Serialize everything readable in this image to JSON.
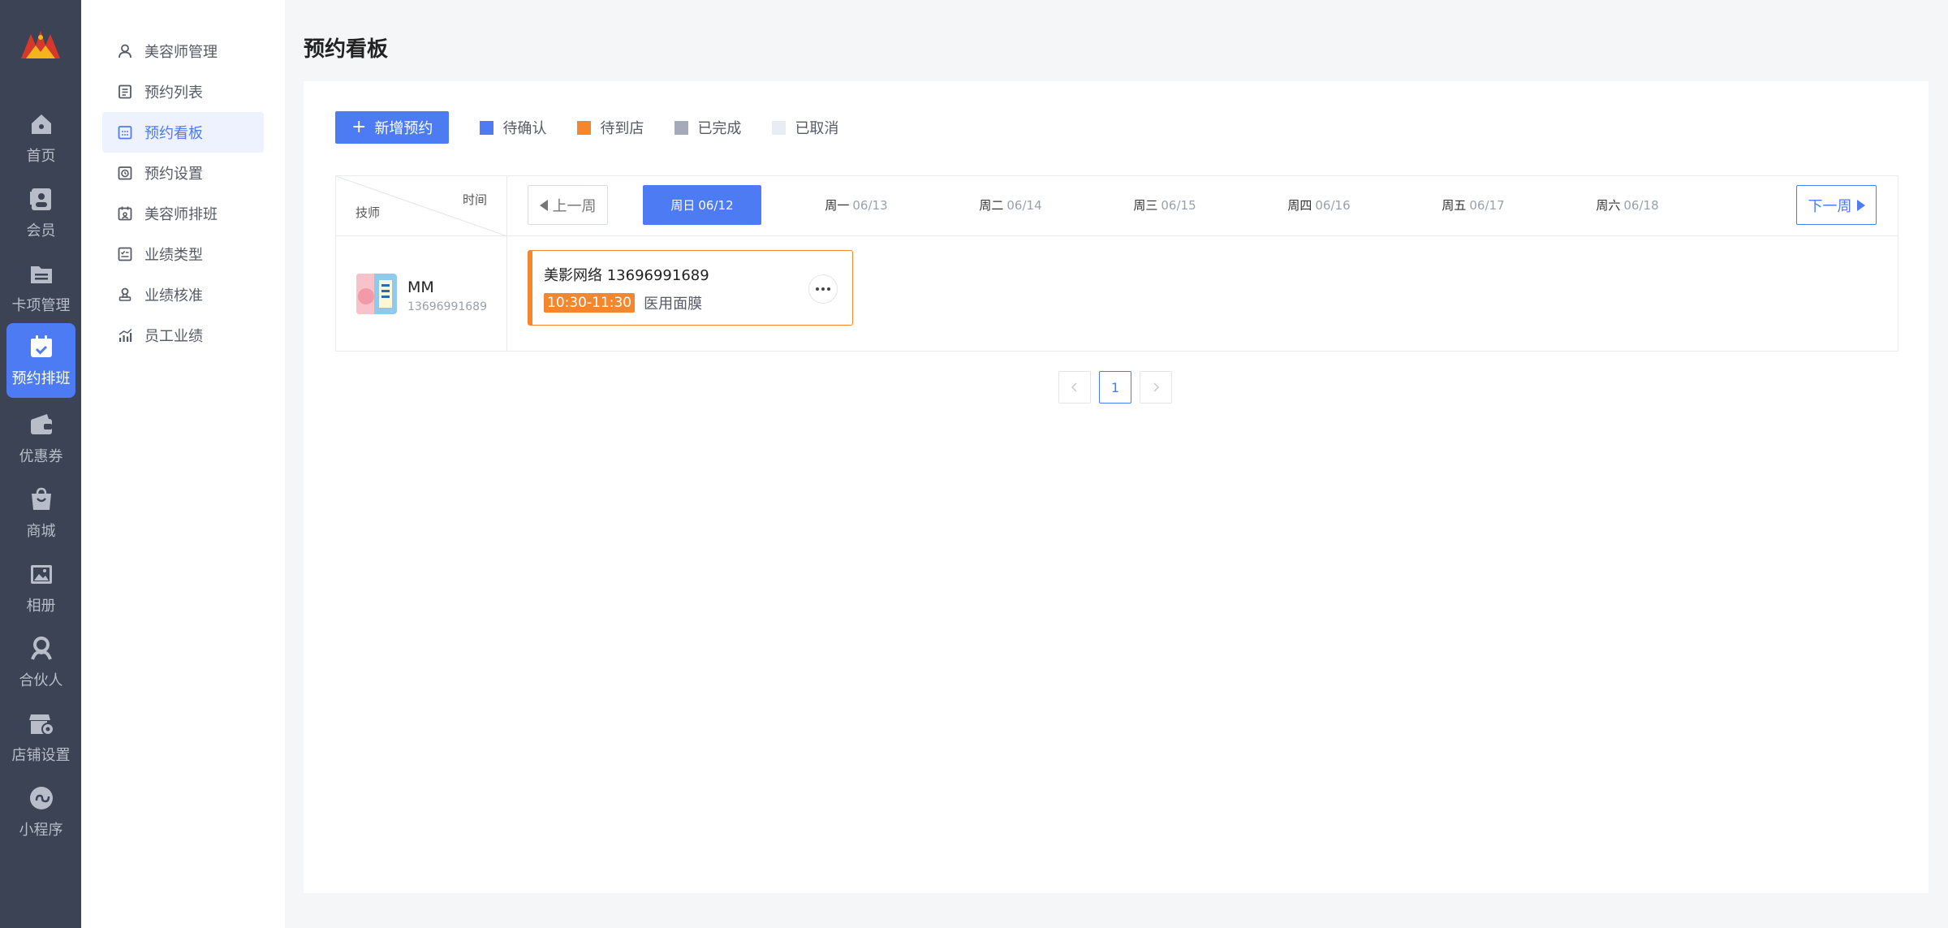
{
  "colors": {
    "accent": "#4d7bf3",
    "rail_bg": "#3b4354",
    "pending_confirm": "#4d7bf3",
    "pending_arrival": "#f5862b",
    "completed": "#a5aab8",
    "cancelled": "#e8ecf4"
  },
  "rail": {
    "items": [
      {
        "label": "首页",
        "icon": "home-icon"
      },
      {
        "label": "会员",
        "icon": "member-card-icon"
      },
      {
        "label": "卡项管理",
        "icon": "folder-icon"
      },
      {
        "label": "预约排班",
        "icon": "calendar-check-icon"
      },
      {
        "label": "优惠券",
        "icon": "wallet-icon"
      },
      {
        "label": "商城",
        "icon": "shopping-bag-icon"
      },
      {
        "label": "相册",
        "icon": "album-icon"
      },
      {
        "label": "合伙人",
        "icon": "partner-icon"
      },
      {
        "label": "店铺设置",
        "icon": "store-settings-icon"
      },
      {
        "label": "小程序",
        "icon": "mini-program-icon"
      }
    ],
    "active_index": 3
  },
  "subnav": {
    "items": [
      {
        "label": "美容师管理",
        "icon": "user-icon"
      },
      {
        "label": "预约列表",
        "icon": "list-icon"
      },
      {
        "label": "预约看板",
        "icon": "board-icon"
      },
      {
        "label": "预约设置",
        "icon": "clock-settings-icon"
      },
      {
        "label": "美容师排班",
        "icon": "schedule-icon"
      },
      {
        "label": "业绩类型",
        "icon": "checklist-icon"
      },
      {
        "label": "业绩核准",
        "icon": "approve-icon"
      },
      {
        "label": "员工业绩",
        "icon": "chart-icon"
      }
    ],
    "active_index": 2
  },
  "page": {
    "title": "预约看板"
  },
  "toolbar": {
    "add_label": "新增预约"
  },
  "legend": [
    {
      "label": "待确认",
      "color": "#4d7bf3"
    },
    {
      "label": "待到店",
      "color": "#f5862b"
    },
    {
      "label": "已完成",
      "color": "#a5aab8"
    },
    {
      "label": "已取消",
      "color": "#e8ecf4"
    }
  ],
  "grid": {
    "corner_time": "时间",
    "corner_tech": "技师",
    "prev_week": "上一周",
    "next_week": "下一周",
    "days": [
      {
        "weekday": "周日",
        "date": "06/12",
        "active": true
      },
      {
        "weekday": "周一",
        "date": "06/13"
      },
      {
        "weekday": "周二",
        "date": "06/14"
      },
      {
        "weekday": "周三",
        "date": "06/15"
      },
      {
        "weekday": "周四",
        "date": "06/16"
      },
      {
        "weekday": "周五",
        "date": "06/17"
      },
      {
        "weekday": "周六",
        "date": "06/18"
      }
    ]
  },
  "technician": {
    "name": "MM",
    "phone": "13696991689"
  },
  "appointment": {
    "title": "美影网络 13696991689",
    "time": "10:30-11:30",
    "service": "医用面膜",
    "status": "待到店"
  },
  "pagination": {
    "current": "1"
  }
}
